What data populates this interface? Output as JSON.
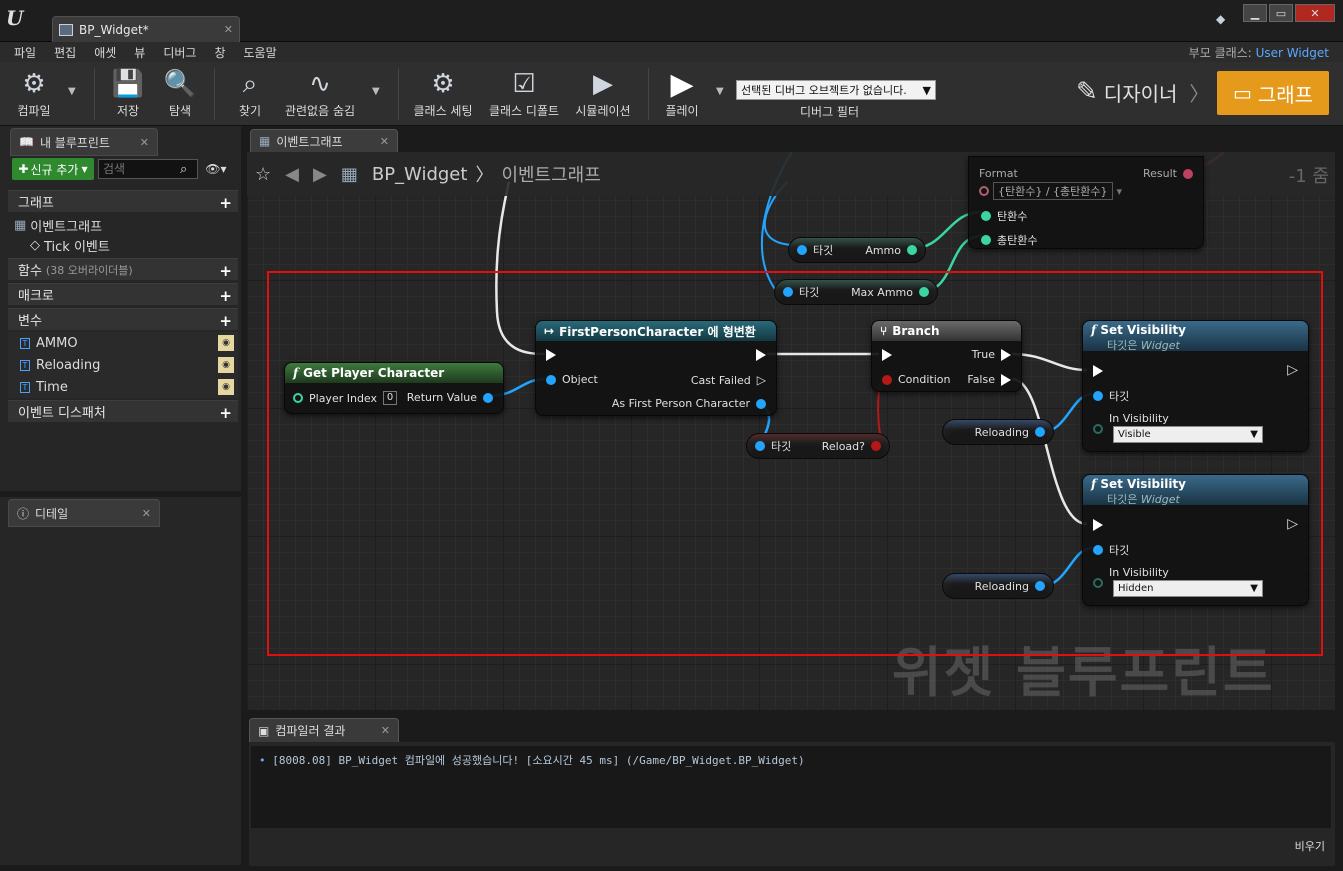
{
  "window": {
    "doc_tab": "BP_Widget*",
    "win_min": "▁",
    "win_max": "▭",
    "win_close": "✕"
  },
  "menu": [
    "파일",
    "편집",
    "애셋",
    "뷰",
    "디버그",
    "창",
    "도움말"
  ],
  "parent_class": {
    "label": "부모 클래스:",
    "value": "User Widget"
  },
  "toolbar": {
    "compile": "컴파일",
    "save": "저장",
    "browse": "탐색",
    "find": "찾기",
    "hide_unrelated": "관련없음 숨김",
    "class_settings": "클래스 세팅",
    "class_defaults": "클래스 디폴트",
    "simulation": "시뮬레이션",
    "play": "플레이",
    "debug_select": "선택된 디버그 오브젝트가 없습니다.",
    "debug_filter": "디버그 필터",
    "designer": "디자이너",
    "graph": "그래프"
  },
  "my_blueprint": {
    "tab": "내 블루프린트",
    "add_new": "신규 추가",
    "search_placeholder": "검색",
    "sections": {
      "graphs": "그래프",
      "functions": "함수",
      "functions_sub": "(38 오버라이더블)",
      "macros": "매크로",
      "variables": "변수",
      "dispatchers": "이벤트 디스패처"
    },
    "graph_items": [
      "이벤트그래프",
      "Tick 이벤트"
    ],
    "variables": [
      "AMMO",
      "Reloading",
      "Time"
    ]
  },
  "details": {
    "tab": "디테일"
  },
  "graph": {
    "tab": "이벤트그래프",
    "breadcrumb_root": "BP_Widget",
    "breadcrumb_leaf": "이벤트그래프",
    "zoom": "-1 줌",
    "watermark": "위젯 블루프린트"
  },
  "nodes": {
    "format": {
      "label": "Format",
      "value": "{탄환수} / {총탄환수}",
      "result": "Result",
      "pin_a": "탄환수",
      "pin_b": "총탄환수"
    },
    "ammo_get": {
      "target": "타깃",
      "label": "Ammo"
    },
    "maxammo_get": {
      "target": "타깃",
      "label": "Max Ammo"
    },
    "get_player": {
      "title": "Get Player Character",
      "pin_index": "Player Index",
      "index_val": "0",
      "ret": "Return Value"
    },
    "cast": {
      "title": "FirstPersonCharacter 에 형변환",
      "object": "Object",
      "failed": "Cast Failed",
      "as": "As First Person Character"
    },
    "reload_get": {
      "target": "타깃",
      "label": "Reload?"
    },
    "branch": {
      "title": "Branch",
      "cond": "Condition",
      "true": "True",
      "false": "False"
    },
    "setvis1": {
      "title": "Set Visibility",
      "sub": "타깃은",
      "sub_i": "Widget",
      "target": "타깃",
      "invis": "In Visibility",
      "value": "Visible"
    },
    "setvis2": {
      "title": "Set Visibility",
      "sub": "타깃은",
      "sub_i": "Widget",
      "target": "타깃",
      "invis": "In Visibility",
      "value": "Hidden"
    },
    "reloading1": {
      "label": "Reloading"
    },
    "reloading2": {
      "label": "Reloading"
    }
  },
  "output": {
    "tab": "컴파일러 결과",
    "log": "[8008.08] BP_Widget 컴파일에 성공했습니다! [소요시간 45 ms] (/Game/BP_Widget.BP_Widget)",
    "clear": "비우기"
  }
}
